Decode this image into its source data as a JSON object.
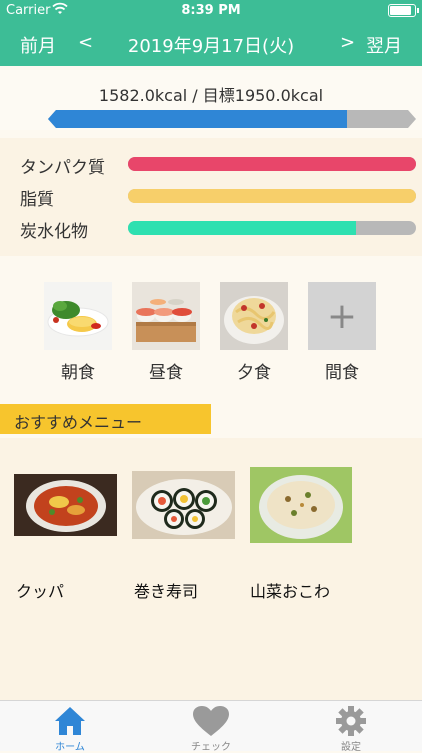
{
  "status": {
    "carrier": "Carrier",
    "time": "8:39 PM"
  },
  "nav": {
    "prev": "前月",
    "prev_arrow": "<",
    "date": "2019年9月17日(火)",
    "next_arrow": ">",
    "next": "翌月"
  },
  "calories": {
    "text": "1582.0kcal / 目標1950.0kcal",
    "consumed": 1582.0,
    "goal": 1950.0
  },
  "nutrients": [
    {
      "label": "タンパク質",
      "fraction": 1.0,
      "color": "#e8466a"
    },
    {
      "label": "脂質",
      "fraction": 1.0,
      "color": "#f7cf6a"
    },
    {
      "label": "炭水化物",
      "fraction": 0.79,
      "color": "#2ee0b0"
    }
  ],
  "meals": [
    {
      "label": "朝食",
      "icon": "omelette-salad-photo"
    },
    {
      "label": "昼食",
      "icon": "sushi-photo"
    },
    {
      "label": "夕食",
      "icon": "pasta-photo"
    },
    {
      "label": "間食",
      "icon": "plus-icon",
      "add": "+"
    }
  ],
  "recommend": {
    "title": "おすすめメニュー",
    "items": [
      {
        "label": "クッパ",
        "icon": "gukbap-photo"
      },
      {
        "label": "巻き寿司",
        "icon": "makizushi-photo"
      },
      {
        "label": "山菜おこわ",
        "icon": "sansai-okowa-photo"
      }
    ]
  },
  "tabs": [
    {
      "label": "ホーム",
      "icon": "home-icon",
      "active": true
    },
    {
      "label": "チェック",
      "icon": "heart-icon",
      "active": false
    },
    {
      "label": "設定",
      "icon": "gear-icon",
      "active": false
    }
  ],
  "colors": {
    "accent": "#3dbd96",
    "calorie_bar": "#2f86d6",
    "recommend_header": "#f7c52d",
    "tab_active": "#2f86d6"
  }
}
